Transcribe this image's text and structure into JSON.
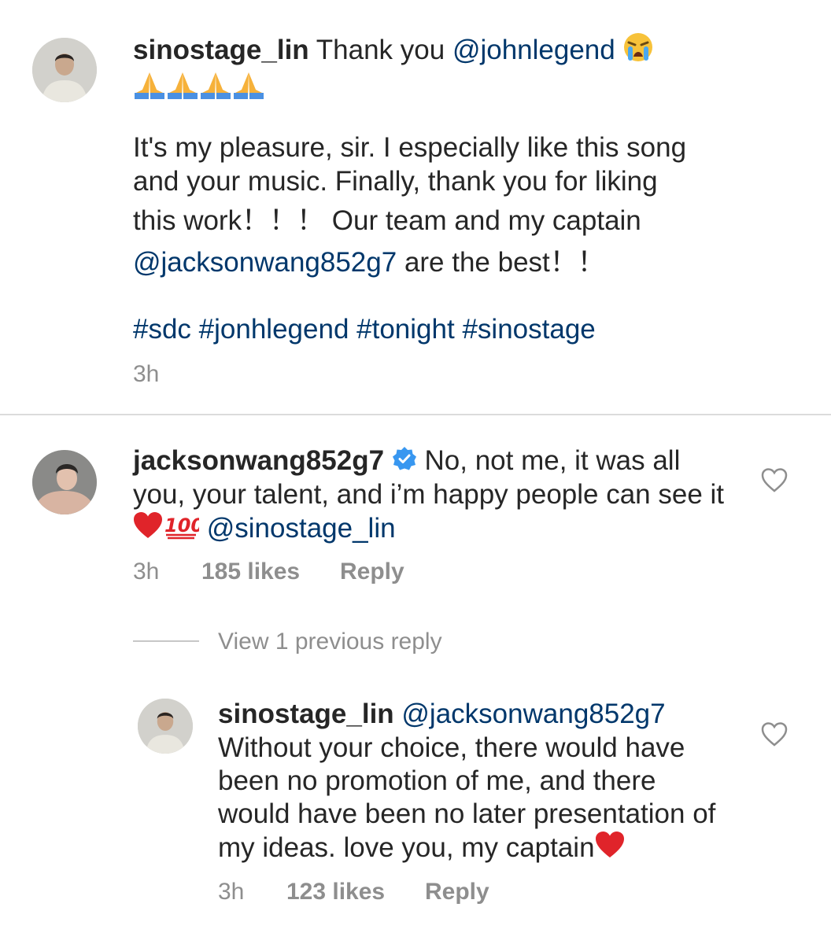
{
  "comment1": {
    "username": "sinostage_lin",
    "text_prefix": "Thank you",
    "mention": "@johnlegend",
    "emoji_crying": "crying-face-emoji",
    "emoji_pray": "folded-hands-emoji",
    "body_line1": "It's my pleasure, sir. I especially like this song",
    "body_line2": "and your music. Finally, thank you for liking",
    "body_line3": "this work！！！ Our team and my captain",
    "body_mention": "@jacksonwang852g7",
    "body_line4_rest": "are the best！！",
    "hashtags": [
      "#sdc",
      "#jonhlegend",
      "#tonight",
      "#sinostage"
    ],
    "time": "3h"
  },
  "comment2": {
    "username": "jacksonwang852g7",
    "verified_icon": "verified-badge-icon",
    "line1": "No, not me, it was all",
    "line2": "you, your talent, and i’m happy people can see it",
    "mention": "@sinostage_lin",
    "time": "3h",
    "likes": "185 likes",
    "reply_label": "Reply"
  },
  "view_replies": "View 1 previous reply",
  "reply1": {
    "username": "sinostage_lin",
    "mention": "@jacksonwang852g7",
    "line1": "Without your choice, there would have",
    "line2": "been no promotion of me, and there",
    "line3": "would have been no later presentation of",
    "line4": "my ideas. love you, my captain",
    "time": "3h",
    "likes": "123 likes",
    "reply_label": "Reply"
  },
  "colors": {
    "link": "#00376b",
    "meta": "#8e8e8e",
    "text": "#262626",
    "verified": "#3897f0",
    "heart_red": "#e0242a"
  }
}
